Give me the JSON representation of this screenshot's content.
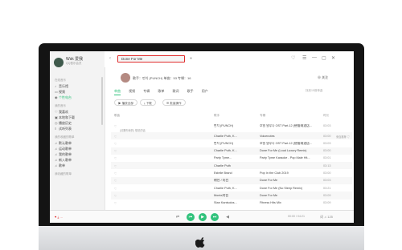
{
  "user": {
    "name": "Wsk 爱我",
    "vip": "QQ音乐会员"
  },
  "sidebar": {
    "sections": [
      {
        "title": "在线音乐",
        "items": [
          {
            "icon": "music-icon",
            "label": "音乐馆"
          },
          {
            "icon": "video-icon",
            "label": "视频"
          },
          {
            "icon": "radio-icon",
            "label": "个性电台",
            "active": true
          }
        ]
      },
      {
        "title": "我的音乐",
        "items": [
          {
            "icon": "heart-icon",
            "label": "我喜欢"
          },
          {
            "icon": "local-icon",
            "label": "本地和下载"
          },
          {
            "icon": "clock-icon",
            "label": "播放历史"
          },
          {
            "icon": "list-icon",
            "label": "试听列表"
          }
        ]
      },
      {
        "title": "我的收藏的歌单",
        "items": [
          {
            "icon": "list-icon",
            "label": "默认歌单"
          },
          {
            "icon": "list-icon",
            "label": "运动歌单"
          },
          {
            "icon": "list-icon",
            "label": "我的歌单"
          },
          {
            "icon": "list-icon",
            "label": "新入歌单"
          },
          {
            "icon": "list-icon",
            "label": "歌单"
          }
        ]
      },
      {
        "title": "我收藏的歌单",
        "items": []
      }
    ]
  },
  "search": {
    "value": "Done For Me"
  },
  "singer": {
    "text": "歌手：펀치 (PUNCH)   单曲：53   专辑：16",
    "follow_button": "⊕ 关注"
  },
  "tabs": [
    "单曲",
    "视频",
    "专辑",
    "歌单",
    "歌词",
    "歌手",
    "用户"
  ],
  "tabs_right": "找到15首单曲",
  "actions": {
    "play_all": "▶ 播放全部",
    "download": "⤓ 下载",
    "batch": "☰ 批量操作"
  },
  "table": {
    "headers": {
      "title": "歌曲",
      "artist": "歌手",
      "album": "专辑",
      "duration": "时长"
    },
    "rows": [
      {
        "title": "Done For Me",
        "badge": "SQ",
        "sub": "(请跟你我的) 想说的话",
        "artist": "펀치 (PUNCH)",
        "album": "호텔 델루나 OST Part.12 (德鲁纳酒店...",
        "duration": "03:03",
        "extra": ""
      },
      {
        "title": "Done For Me",
        "badge": "SQ",
        "sub": "",
        "artist": "Charlie Puth, K...",
        "album": "Voicenotes",
        "duration": "03:00",
        "extra": "来自推荐 ♡"
      },
      {
        "title": "Done For Me (Instrumental)",
        "badge": "SQ",
        "sub": "",
        "artist": "펀치 (PUNCH)",
        "album": "호텔 델루나 OST Part.12 (德鲁纳酒店...",
        "duration": "03:03",
        "extra": ""
      },
      {
        "title": "Done For Me (Loud Luxury Remix)",
        "badge": "SQ",
        "sub": "",
        "artist": "Charlie Puth, K...",
        "album": "Done For Me (Loud Luxury Remix)",
        "duration": "03:00",
        "extra": ""
      },
      {
        "title": "Done For Me(Made Popular By Charlie...",
        "badge": "",
        "sub": "",
        "artist": "Party Tyme...",
        "album": "Party Tyme Karaoke - Pop Male Hit...",
        "duration": "03:01",
        "extra": ""
      },
      {
        "title": "Done For Me (Jazz Version)",
        "badge": "SQ",
        "sub": "",
        "artist": "Charlie Puth",
        "album": "",
        "duration": "03:13",
        "extra": ""
      },
      {
        "title": "Done For Me (Pop Mix Charlie Puth Feat...",
        "badge": "SQ",
        "sub": "",
        "artist": "Estelle Brand",
        "album": "Pop In the Club 2019",
        "duration": "03:00",
        "extra": ""
      },
      {
        "title": "Done For Me",
        "badge": "SQ",
        "sub": "",
        "artist": "朝台 / 阿白",
        "album": "Done For Me",
        "duration": "03:03",
        "extra": ""
      },
      {
        "title": "Done For Me (No Sleep Remix)",
        "badge": "SQ",
        "sub": "",
        "artist": "Charlie Puth, K...",
        "album": "Done For Me (No Sleep Remix)",
        "duration": "03:21",
        "extra": ""
      },
      {
        "title": "Done For Me",
        "badge": "SQ",
        "sub": "",
        "artist": "Monte刘哲",
        "album": "Done For Me",
        "duration": "03:09",
        "extra": ""
      },
      {
        "title": "Done For Me",
        "badge": "SQ",
        "sub": "",
        "artist": "Stan Kantsolos...",
        "album": "Fitness Hits Mix",
        "duration": "03:09",
        "extra": ""
      }
    ]
  },
  "player": {
    "time": "00:00 / 04:21",
    "right": "词 ♫ 125",
    "left": "♥ ⤓ ⋯"
  },
  "window": {
    "controls": [
      "♡",
      "☰",
      "—",
      "▢",
      "✕"
    ]
  }
}
